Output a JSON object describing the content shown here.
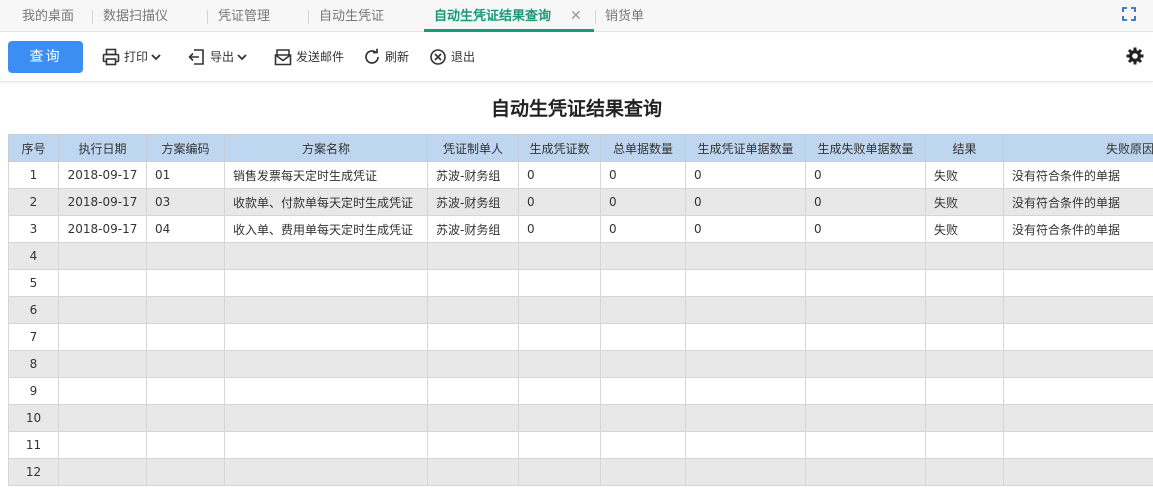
{
  "tabs": [
    "我的桌面",
    "数据扫描仪",
    "凭证管理",
    "自动生凭证",
    "自动生凭证结果查询",
    "销货单"
  ],
  "tab_close": "✕",
  "toolbar": {
    "query": "查询",
    "print": "打印",
    "export": "导出",
    "send_mail": "发送邮件",
    "refresh": "刷新",
    "exit": "退出"
  },
  "page_title": "自动生凭证结果查询",
  "table": {
    "headers": [
      "序号",
      "执行日期",
      "方案编码",
      "方案名称",
      "凭证制单人",
      "生成凭证数",
      "总单据数量",
      "生成凭证单据数量",
      "生成失败单据数量",
      "结果",
      "失败原因"
    ],
    "rows": [
      [
        "1",
        "2018-09-17",
        "01",
        "销售发票每天定时生成凭证",
        "苏波-财务组",
        "0",
        "0",
        "0",
        "0",
        "失败",
        "没有符合条件的单据"
      ],
      [
        "2",
        "2018-09-17",
        "03",
        "收款单、付款单每天定时生成凭证",
        "苏波-财务组",
        "0",
        "0",
        "0",
        "0",
        "失败",
        "没有符合条件的单据"
      ],
      [
        "3",
        "2018-09-17",
        "04",
        "收入单、费用单每天定时生成凭证",
        "苏波-财务组",
        "0",
        "0",
        "0",
        "0",
        "失败",
        "没有符合条件的单据"
      ],
      [
        "4",
        "",
        "",
        "",
        "",
        "",
        "",
        "",
        "",
        "",
        ""
      ],
      [
        "5",
        "",
        "",
        "",
        "",
        "",
        "",
        "",
        "",
        "",
        ""
      ],
      [
        "6",
        "",
        "",
        "",
        "",
        "",
        "",
        "",
        "",
        "",
        ""
      ],
      [
        "7",
        "",
        "",
        "",
        "",
        "",
        "",
        "",
        "",
        "",
        ""
      ],
      [
        "8",
        "",
        "",
        "",
        "",
        "",
        "",
        "",
        "",
        "",
        ""
      ],
      [
        "9",
        "",
        "",
        "",
        "",
        "",
        "",
        "",
        "",
        "",
        ""
      ],
      [
        "10",
        "",
        "",
        "",
        "",
        "",
        "",
        "",
        "",
        "",
        ""
      ],
      [
        "11",
        "",
        "",
        "",
        "",
        "",
        "",
        "",
        "",
        "",
        ""
      ],
      [
        "12",
        "",
        "",
        "",
        "",
        "",
        "",
        "",
        "",
        "",
        ""
      ]
    ]
  },
  "icons": {
    "print": "printer-icon",
    "export": "export-icon",
    "send_mail": "mail-icon",
    "refresh": "refresh-icon",
    "exit": "exit-icon",
    "settings": "gear-icon",
    "fullscreen": "fullscreen-icon"
  },
  "colors": {
    "active_tab": "#1a9a78",
    "query_button": "#3d8ef3",
    "table_header": "#bed6ef",
    "zero_values": "#2c3fcb"
  }
}
